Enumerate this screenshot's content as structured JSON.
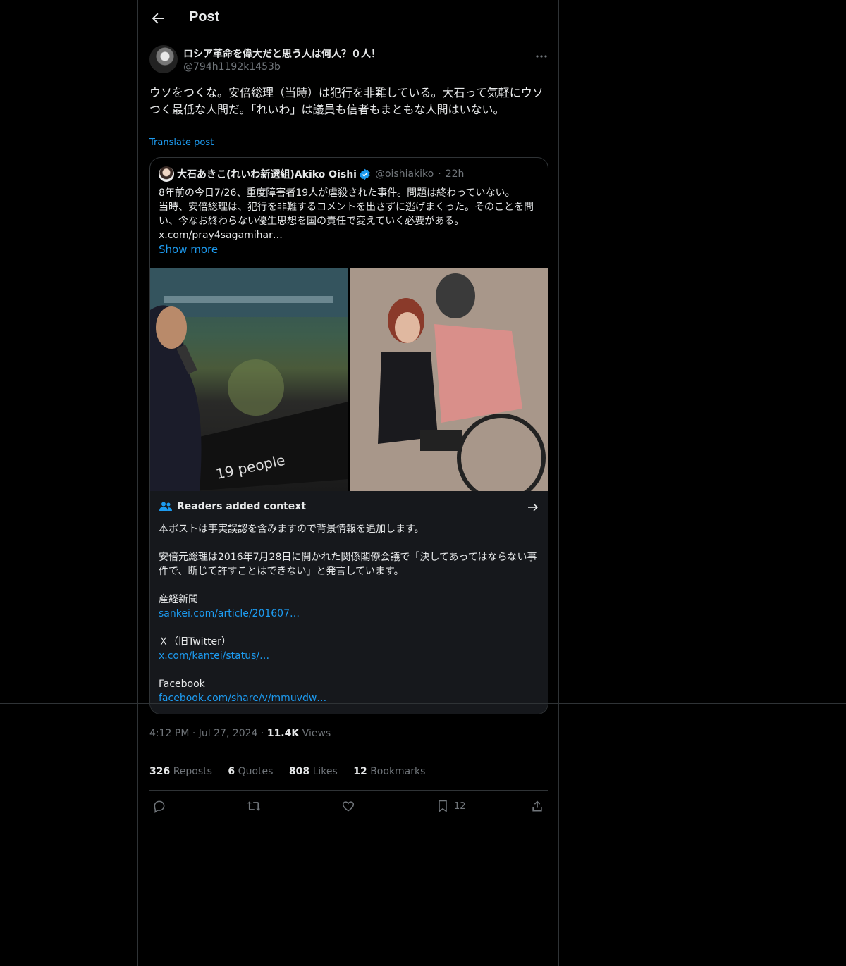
{
  "header": {
    "title": "Post"
  },
  "post": {
    "display_name": "ロシア革命を偉大だと思う人は何人？０人！",
    "handle": "@794h1192k1453b",
    "text": "ウソをつくな。安倍総理（当時）は犯行を非難している。大石って気軽にウソつく最低な人間だ。「れいわ」は議員も信者もまともな人間はいない。",
    "translate_label": "Translate post"
  },
  "quote": {
    "display_name": "大石あきこ(れいわ新選組)Akiko Oishi",
    "handle": "@oishiakiko",
    "time": "22h",
    "text": "8年前の今日7/26、重度障害者19人が虐殺された事件。問題は終わっていない。\n当時、安倍総理は、犯行を非難するコメントを出さずに逃げまくった。そのことを問い、今なお終わらない優生思想を国の責任で変えていく必要がある。\nx.com/pray4sagamihar…",
    "show_more": "Show more",
    "photo_text": "19 people"
  },
  "notes": {
    "heading": "Readers added context",
    "intro": "本ポストは事実誤認を含みますので背景情報を追加します。",
    "detail": "安倍元総理は2016年7月28日に開かれた関係閣僚会議で「決してあってはならない事件で、断じて許すことはできない」と発言しています。",
    "source1_label": "産経新聞",
    "source1_link": "sankei.com/article/201607…",
    "source2_label": "Ｘ（旧Twitter）",
    "source2_link": "x.com/kantei/status/…",
    "source3_label": "Facebook",
    "source3_link": "facebook.com/share/v/mmuvdw…"
  },
  "meta": {
    "time": "4:12 PM",
    "date": "Jul 27, 2024",
    "views_count": "11.4K",
    "views_label": "Views"
  },
  "stats": {
    "reposts_count": "326",
    "reposts_label": "Reposts",
    "quotes_count": "6",
    "quotes_label": "Quotes",
    "likes_count": "808",
    "likes_label": "Likes",
    "bookmarks_count": "12",
    "bookmarks_label": "Bookmarks"
  },
  "actions": {
    "bookmark_count": "12"
  },
  "icons": [
    "back-arrow-icon",
    "more-icon",
    "verified-icon",
    "readers-icon",
    "arrow-right-icon",
    "reply-icon",
    "repost-icon",
    "like-icon",
    "bookmark-icon",
    "share-icon"
  ],
  "colors": {
    "background": "#000000",
    "text": "#e7e9ea",
    "muted": "#71767b",
    "accent": "#1d9bf0",
    "border": "#2f3336",
    "notes_bg": "#16181c"
  }
}
